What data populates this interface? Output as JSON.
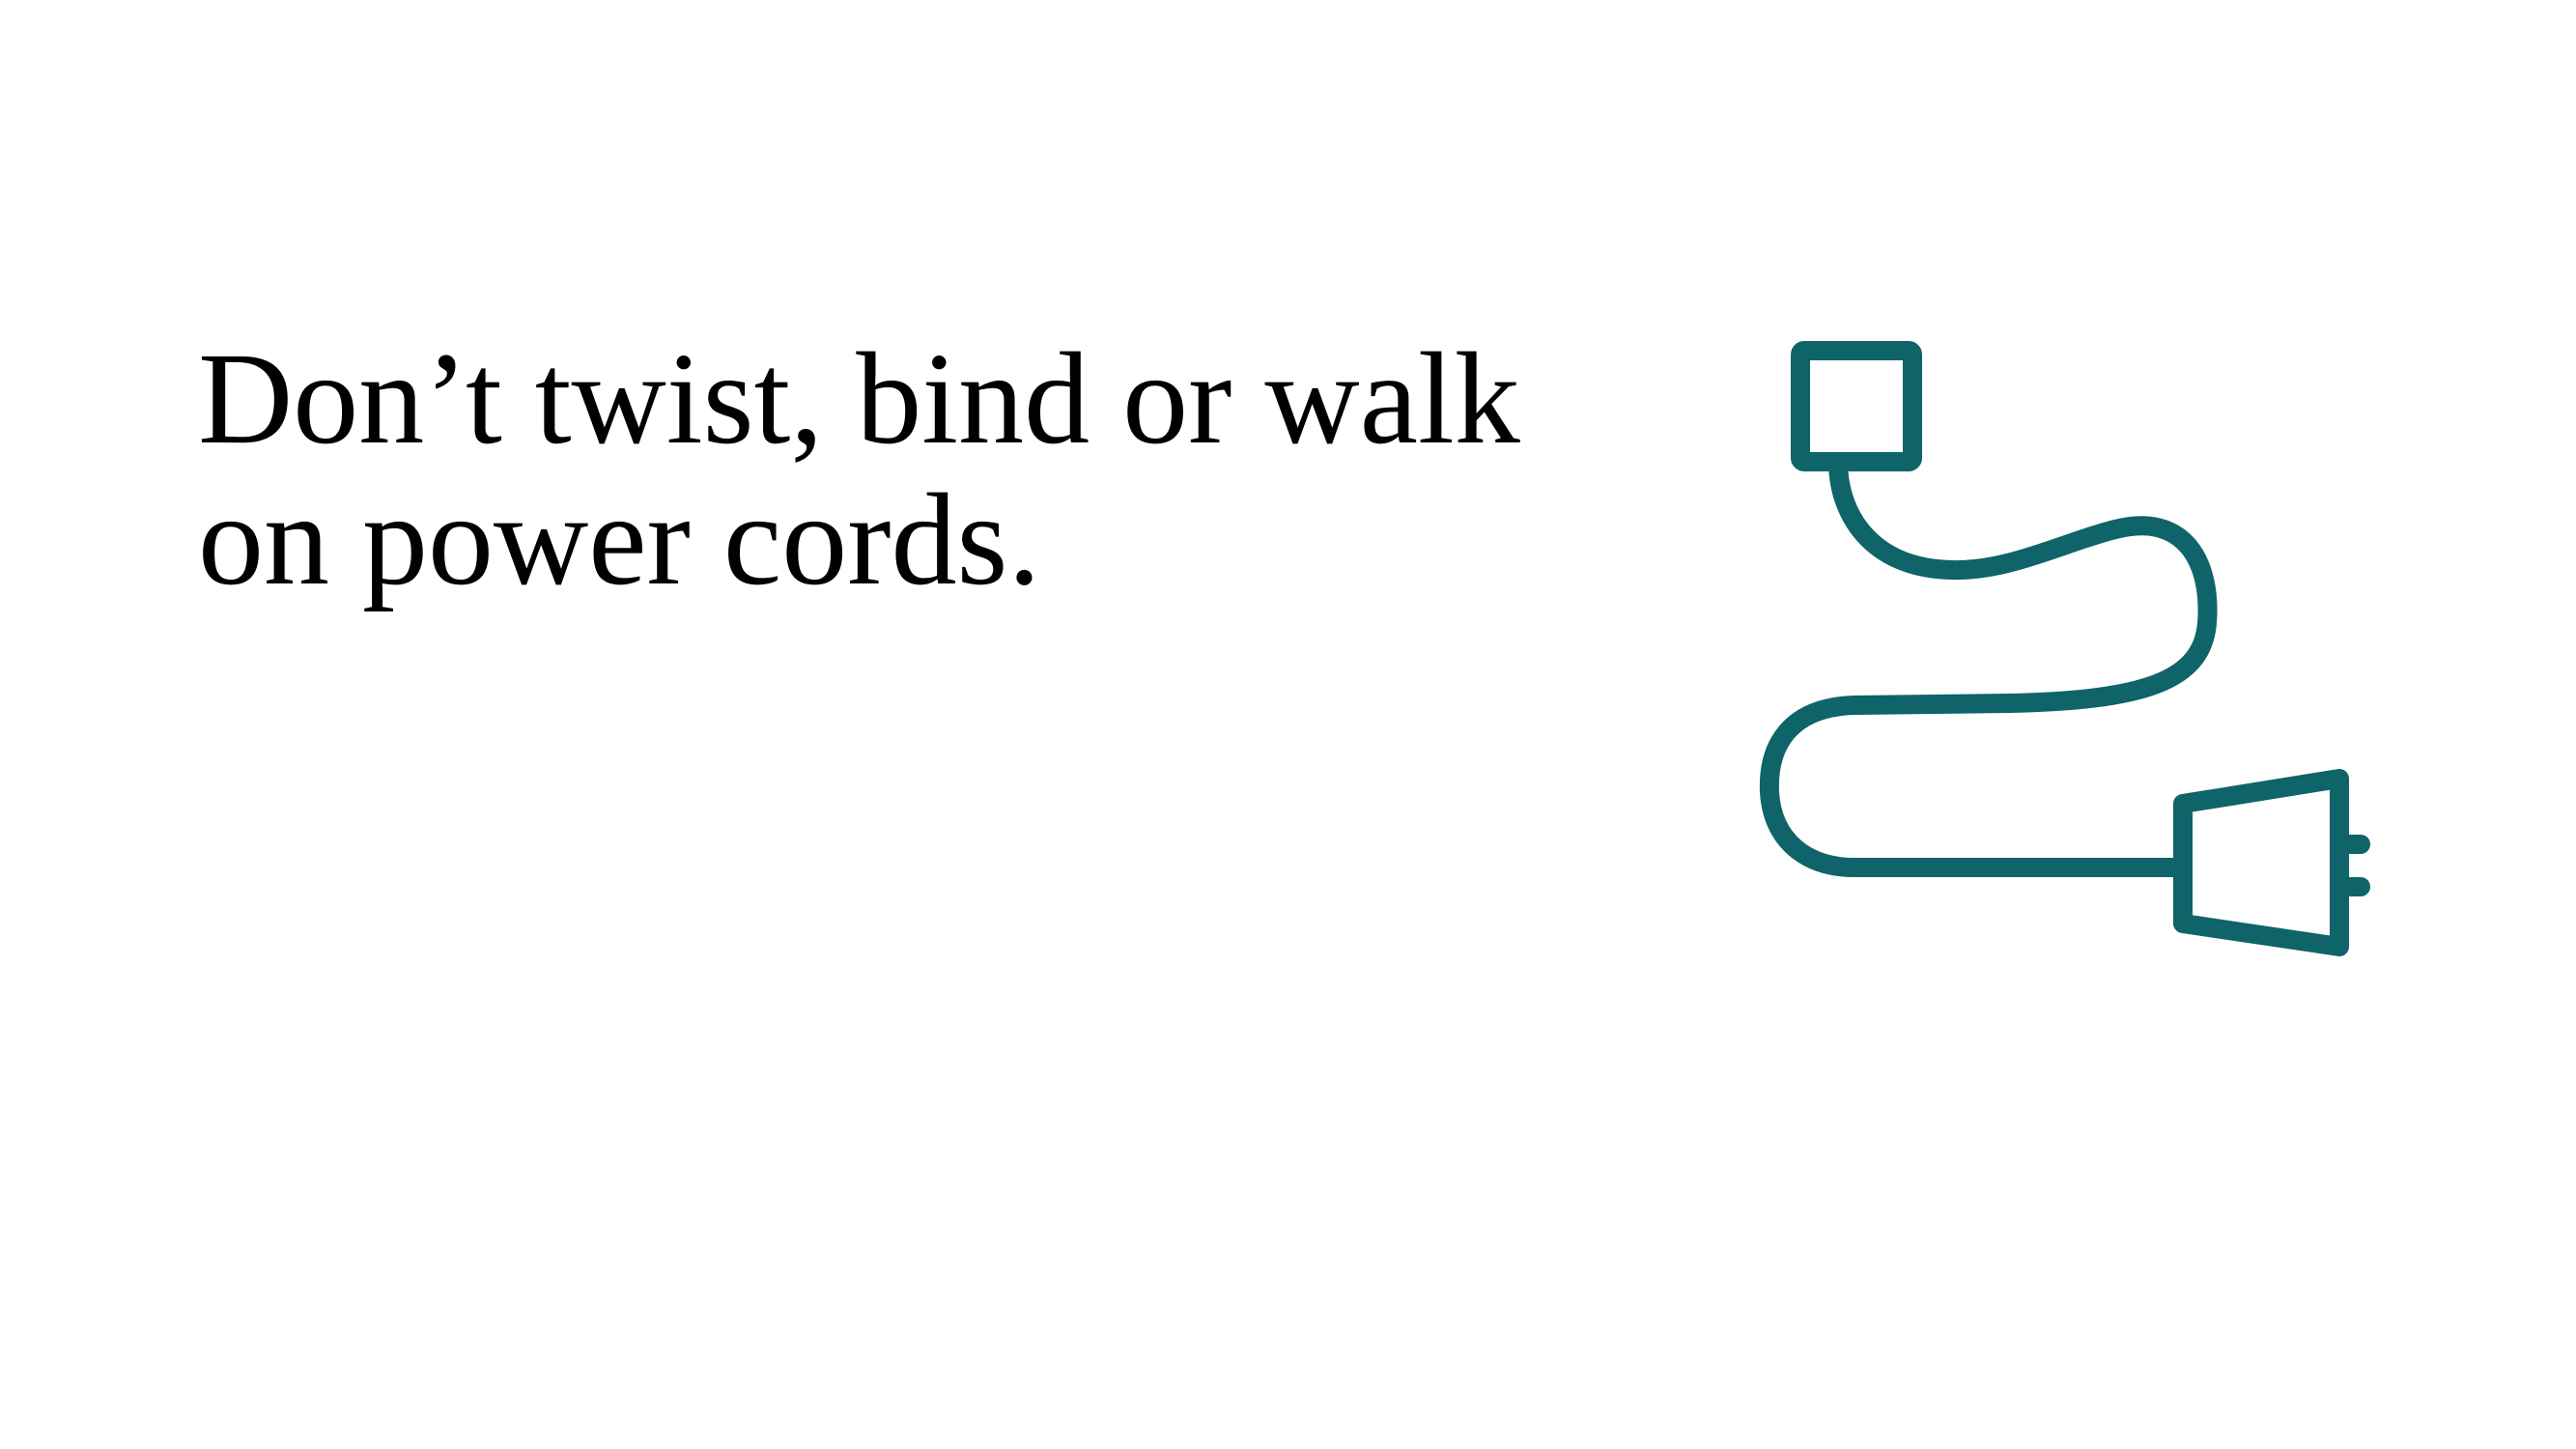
{
  "slide": {
    "headline_line_1": "Don’t twist, bind or walk",
    "headline_line_2": "on power cords."
  },
  "illustration": {
    "icon": "power-cord-icon",
    "color": "#0e6469"
  }
}
